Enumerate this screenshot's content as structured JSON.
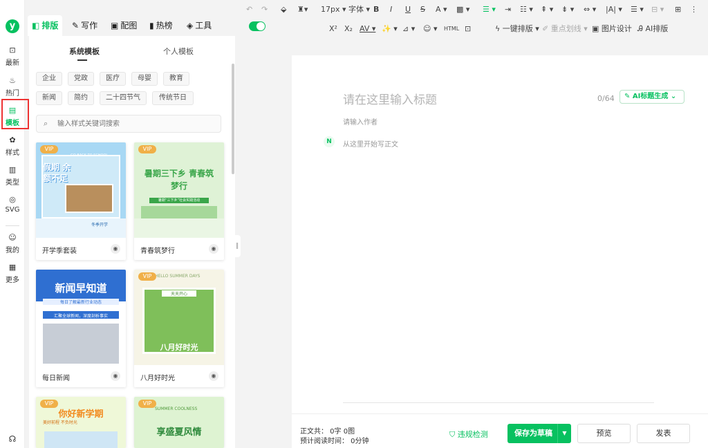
{
  "brand": {
    "logo": "y",
    "accent": "#07c160"
  },
  "rail": [
    {
      "label": "最新",
      "icon": "latest-icon"
    },
    {
      "label": "热门",
      "icon": "hot-icon"
    },
    {
      "label": "模板",
      "icon": "template-icon",
      "active": true
    },
    {
      "label": "样式",
      "icon": "style-icon"
    },
    {
      "label": "类型",
      "icon": "type-icon"
    },
    {
      "label": "SVG",
      "icon": "svg-icon"
    },
    {
      "label": "我的",
      "icon": "user-icon"
    },
    {
      "label": "更多",
      "icon": "more-icon"
    }
  ],
  "tabs": [
    "排版",
    "写作",
    "配图",
    "热榜",
    "工具"
  ],
  "toolbar": {
    "font_size": "17px",
    "font": "字体",
    "row2": [
      "X²",
      "X₂",
      "一键排版",
      "重点划线",
      "图片设计",
      "AI排版"
    ]
  },
  "panel": {
    "tabs": [
      "系统模板",
      "个人模板"
    ],
    "categories": [
      "企业",
      "党政",
      "医疗",
      "母婴",
      "教育",
      "新闻",
      "简约",
      "二十四节气",
      "传统节日"
    ],
    "search_placeholder": "输入样式关键词搜索",
    "vip": "VIP",
    "cards": [
      {
        "name": "开学季套装",
        "title": "假期 余额不足",
        "tagline": "GO BACK TO SCHOOL",
        "caption": "冬季开学"
      },
      {
        "name": "青春筑梦行",
        "title": "暑期三下乡 青春筑梦行",
        "caption": "暑期“三下乡”社会实践活动"
      },
      {
        "name": "每日新闻",
        "title": "新闻早知道",
        "subtitle": "每日了解最新行业动态",
        "tagline": "汇聚全球新闻，深度剖析事实"
      },
      {
        "name": "八月好时光",
        "title": "八月好时光",
        "tagline": "HELLO SUMMER DAYS",
        "caption": "天天开心"
      },
      {
        "name": "你好新学期",
        "title": "你好新学期",
        "tagline": "美好前程 不负时光"
      },
      {
        "name": "享盛夏风情",
        "title": "享盛夏风情",
        "tagline": "SUMMER COOLNESS"
      }
    ]
  },
  "editor": {
    "title_placeholder": "请在这里输入标题",
    "title_count": "0/64",
    "ai_title_button": "AI标题生成",
    "author_placeholder": "请输入作者",
    "body_placeholder": "从这里开始写正文"
  },
  "bottom": {
    "word_count": "正文共： 0字 0图",
    "read_time": "预计阅读时间： 0分钟",
    "violation_check": "违规检测",
    "save_draft": "保存为草稿",
    "preview": "预览",
    "publish": "发表"
  }
}
